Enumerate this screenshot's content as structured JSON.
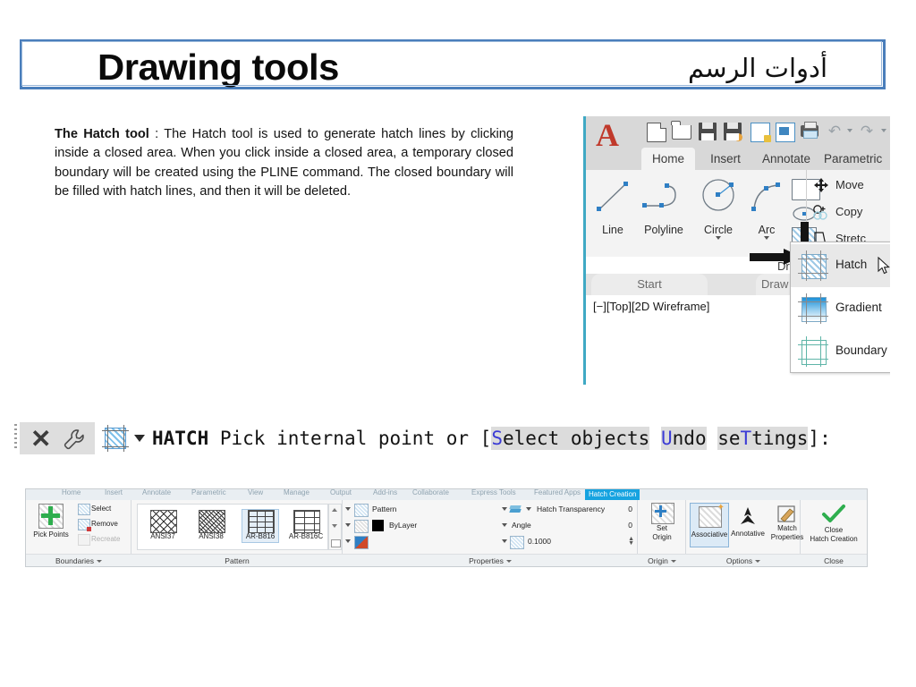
{
  "slide": {
    "title_en": "Drawing tools",
    "title_ar": "أدوات الرسم",
    "body_bold": "The Hatch tool",
    "body_rest": " : The Hatch tool is used to generate hatch lines by clicking inside a closed area. When you click inside a closed area, a temporary closed boundary will be created using the PLINE command. The closed boundary will be filled with hatch lines, and then it will be deleted.",
    "border_color": "#4a7ebb"
  },
  "autocad": {
    "logo": "A",
    "quick_access": [
      {
        "name": "new-document-icon"
      },
      {
        "name": "open-folder-icon"
      },
      {
        "name": "save-icon"
      },
      {
        "name": "save-as-icon"
      },
      {
        "name": "lock-icon"
      },
      {
        "name": "export-icon"
      },
      {
        "name": "print-icon"
      },
      {
        "name": "undo-icon"
      },
      {
        "name": "redo-icon"
      }
    ],
    "tabs": [
      {
        "label": "Home",
        "active": true
      },
      {
        "label": "Insert",
        "active": false
      },
      {
        "label": "Annotate",
        "active": false
      },
      {
        "label": "Parametric",
        "active": false
      }
    ],
    "draw_tools": [
      {
        "label": "Line",
        "icon": "line-icon",
        "has_caret": false
      },
      {
        "label": "Polyline",
        "icon": "polyline-icon",
        "has_caret": false
      },
      {
        "label": "Circle",
        "icon": "circle-icon",
        "has_caret": true
      },
      {
        "label": "Arc",
        "icon": "arc-icon",
        "has_caret": true
      }
    ],
    "modify_tools": [
      {
        "label": "Move",
        "icon": "move-icon"
      },
      {
        "label": "Copy",
        "icon": "copy-icon"
      },
      {
        "label": "Stretc",
        "icon": "stretch-icon"
      }
    ],
    "draw_panel_label": "Draw",
    "file_tabs": [
      {
        "label": "Start"
      },
      {
        "label": "Draw"
      }
    ],
    "viewport_label": "[−][Top][2D Wireframe]",
    "hatch_menu": [
      {
        "label": "Hatch",
        "icon": "hatch-pattern-icon",
        "selected": true
      },
      {
        "label": "Gradient",
        "icon": "gradient-icon",
        "selected": false
      },
      {
        "label": "Boundary",
        "icon": "boundary-icon",
        "selected": false
      }
    ]
  },
  "command_line": {
    "command": "HATCH",
    "prompt_prefix": "Pick internal point or [",
    "options": [
      {
        "hotkey": "S",
        "rest": "elect objects"
      },
      {
        "hotkey": "U",
        "rest_pre": "",
        "rest": "ndo"
      },
      {
        "hotkey": "T",
        "pre": "se",
        "rest": "tings"
      }
    ],
    "prompt_suffix": "]:",
    "icons": [
      {
        "name": "close-icon",
        "glyph": "✕"
      },
      {
        "name": "wrench-icon"
      },
      {
        "name": "hatch-icon"
      },
      {
        "name": "dropdown-caret-icon"
      }
    ]
  },
  "hatch_ribbon": {
    "tabs": [
      {
        "label": "Home",
        "ctx": false
      },
      {
        "label": "Insert",
        "ctx": false
      },
      {
        "label": "Annotate",
        "ctx": false
      },
      {
        "label": "Parametric",
        "ctx": false
      },
      {
        "label": "View",
        "ctx": false
      },
      {
        "label": "Manage",
        "ctx": false
      },
      {
        "label": "Output",
        "ctx": false
      },
      {
        "label": "Add-ins",
        "ctx": false
      },
      {
        "label": "Collaborate",
        "ctx": false
      },
      {
        "label": "Express Tools",
        "ctx": false
      },
      {
        "label": "Featured Apps",
        "ctx": false
      },
      {
        "label": "Hatch Creation",
        "ctx": true
      }
    ],
    "panels": [
      {
        "label": "Boundaries",
        "caret": true
      },
      {
        "label": "Pattern",
        "caret": false
      },
      {
        "label": "Properties",
        "caret": true
      },
      {
        "label": "Origin",
        "caret": true
      },
      {
        "label": "Options",
        "caret": true
      },
      {
        "label": "Close",
        "caret": false
      }
    ],
    "boundaries": {
      "big_button": "Pick Points",
      "items": [
        {
          "label": "Select",
          "enabled": true
        },
        {
          "label": "Remove",
          "enabled": true
        },
        {
          "label": "Recreate",
          "enabled": false
        }
      ]
    },
    "patterns": [
      {
        "label": "ANSI37",
        "selected": false
      },
      {
        "label": "ANSI38",
        "selected": false
      },
      {
        "label": "AR-B816",
        "selected": true
      },
      {
        "label": "AR-B816C",
        "selected": false
      }
    ],
    "properties": [
      {
        "name": "Pattern",
        "value": ""
      },
      {
        "name": "ByLayer",
        "value": ""
      },
      {
        "name": "",
        "value": ""
      },
      {
        "name": "Hatch Transparency",
        "value": "0"
      },
      {
        "name": "Angle",
        "value": "0"
      },
      {
        "name": "",
        "value": "0.1000"
      }
    ],
    "origin": {
      "label_line1": "Set",
      "label_line2": "Origin"
    },
    "options": [
      {
        "label": "Associative",
        "selected": true
      },
      {
        "label": "Annotative",
        "selected": false
      },
      {
        "label_line1": "Match",
        "label_line2": "Properties",
        "label": "Match Properties",
        "selected": false
      }
    ],
    "close": {
      "label_line1": "Close",
      "label_line2": "Hatch Creation"
    }
  }
}
